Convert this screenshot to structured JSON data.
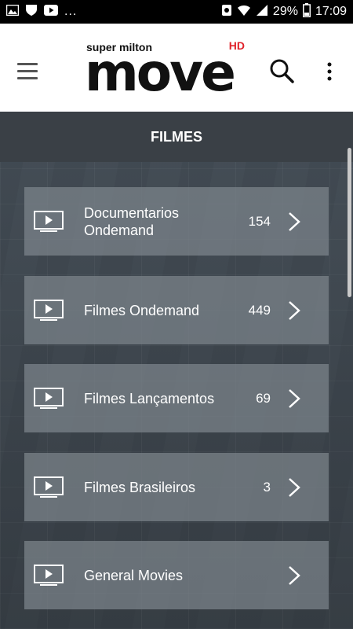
{
  "status_bar": {
    "left_icons": [
      "gallery-icon",
      "shield-icon",
      "youtube-icon"
    ],
    "overflow": "...",
    "battery": "29%",
    "time": "17:09"
  },
  "app_bar": {
    "logo": {
      "small_text": "super milton",
      "main_text": "move",
      "badge": "HD"
    },
    "icons": [
      "menu-icon",
      "search-icon",
      "more-vert-icon"
    ]
  },
  "section": {
    "title": "FILMES"
  },
  "categories": [
    {
      "label": "Documentarios Ondemand",
      "count": "154"
    },
    {
      "label": "Filmes Ondemand",
      "count": "449"
    },
    {
      "label": "Filmes Lançamentos",
      "count": "69"
    },
    {
      "label": "Filmes Brasileiros",
      "count": "3"
    },
    {
      "label": "General Movies",
      "count": ""
    }
  ]
}
